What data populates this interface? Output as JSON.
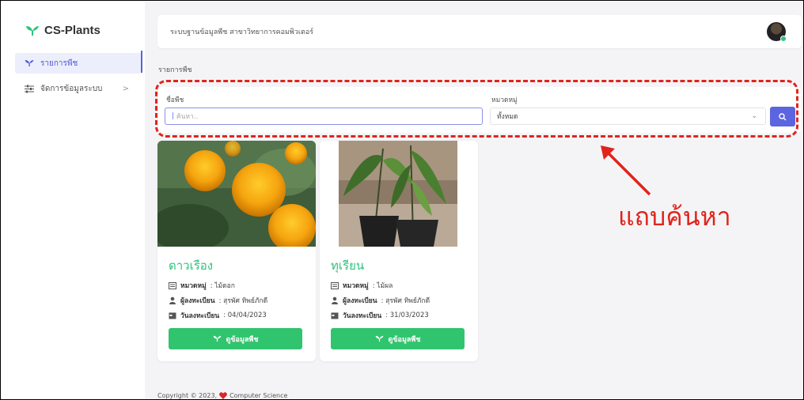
{
  "brand": {
    "name": "CS-Plants",
    "accent": "#2ec27e"
  },
  "sidebar": {
    "items": [
      {
        "label": "รายการพืช",
        "icon": "sprout-icon",
        "active": true
      },
      {
        "label": "จัดการข้อมูลระบบ",
        "icon": "sliders-icon",
        "chevron": ">"
      }
    ]
  },
  "topbar": {
    "title": "ระบบฐานข้อมูลพืช สาขาวิทยาการคอมพิวเตอร์"
  },
  "breadcrumb": "รายการพืช",
  "search": {
    "name_label": "ชื่อพืช",
    "name_placeholder": "ค้นหา..",
    "category_label": "หมวดหมู่",
    "category_value": "ทั้งหมด"
  },
  "cards": [
    {
      "title": "ดาวเรือง",
      "category_label": "หมวดหมู่",
      "category": ": ไม้ดอก",
      "registrar_label": "ผู้ลงทะเบียน",
      "registrar": ": สุรพัศ ทิพย์ภักดี",
      "date_label": "วันลงทะเบียน",
      "date": ": 04/04/2023",
      "button": "ดูข้อมูลพืช"
    },
    {
      "title": "ทุเรียน",
      "category_label": "หมวดหมู่",
      "category": ": ไม้ผล",
      "registrar_label": "ผู้ลงทะเบียน",
      "registrar": ": สุรพัศ ทิพย์ภักดี",
      "date_label": "วันลงทะเบียน",
      "date": ": 31/03/2023",
      "button": "ดูข้อมูลพืช"
    }
  ],
  "footer": {
    "text": "Copyright © 2023,",
    "org": "Computer Science"
  },
  "annotation": {
    "label": "แถบค้นหา",
    "color": "#e0241b"
  }
}
